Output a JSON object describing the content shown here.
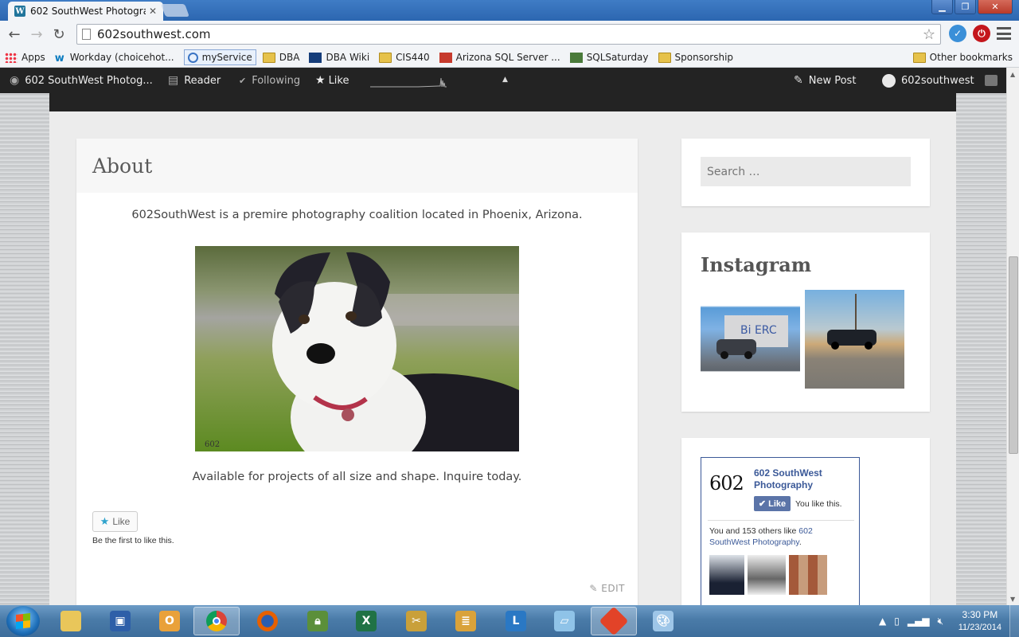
{
  "browser": {
    "tab_title": "602 SouthWest Photograp",
    "tab_favicon": "wordpress-icon",
    "url": "602southwest.com",
    "bookmarks": [
      {
        "label": "Apps",
        "icon": "apps-grid-icon"
      },
      {
        "label": "Workday (choicehot...",
        "icon": "workday-icon"
      },
      {
        "label": "myService",
        "icon": "service-icon"
      },
      {
        "label": "DBA",
        "icon": "folder-icon"
      },
      {
        "label": "DBA Wiki",
        "icon": "wiki-icon"
      },
      {
        "label": "CIS440",
        "icon": "folder-icon"
      },
      {
        "label": "Arizona SQL Server ...",
        "icon": "sql-server-icon"
      },
      {
        "label": "SQLSaturday",
        "icon": "sqlsaturday-icon"
      },
      {
        "label": "Sponsorship",
        "icon": "folder-icon"
      }
    ],
    "other_bookmarks": "Other bookmarks"
  },
  "adminbar": {
    "site_name": "602 SouthWest Photog...",
    "reader": "Reader",
    "following": "Following",
    "like": "Like",
    "new_post": "New Post",
    "user": "602southwest"
  },
  "page": {
    "title": "About",
    "intro": "602SouthWest is a premire photography coalition located in Phoenix, Arizona.",
    "photo_watermark": "602",
    "availability": "Available for projects of all size and shape. Inquire today.",
    "like_button": "Like",
    "like_note": "Be the first to like this.",
    "edit_link": "EDIT"
  },
  "sidebar": {
    "search_placeholder": "Search …",
    "instagram_title": "Instagram",
    "facebook": {
      "logo": "602",
      "page_name": "602 SouthWest Photography",
      "like_button": "Like",
      "you_like": "You like this.",
      "count_text": "You and 153 others like ",
      "count_link": "602 SouthWest Photography",
      "count_end": "."
    }
  },
  "taskbar": {
    "time": "3:30 PM",
    "date": "11/23/2014"
  },
  "colors": {
    "admin_bar": "#232323",
    "wp_blue": "#21759b",
    "facebook_blue": "#3b5998",
    "like_star": "#2ea2cc"
  }
}
